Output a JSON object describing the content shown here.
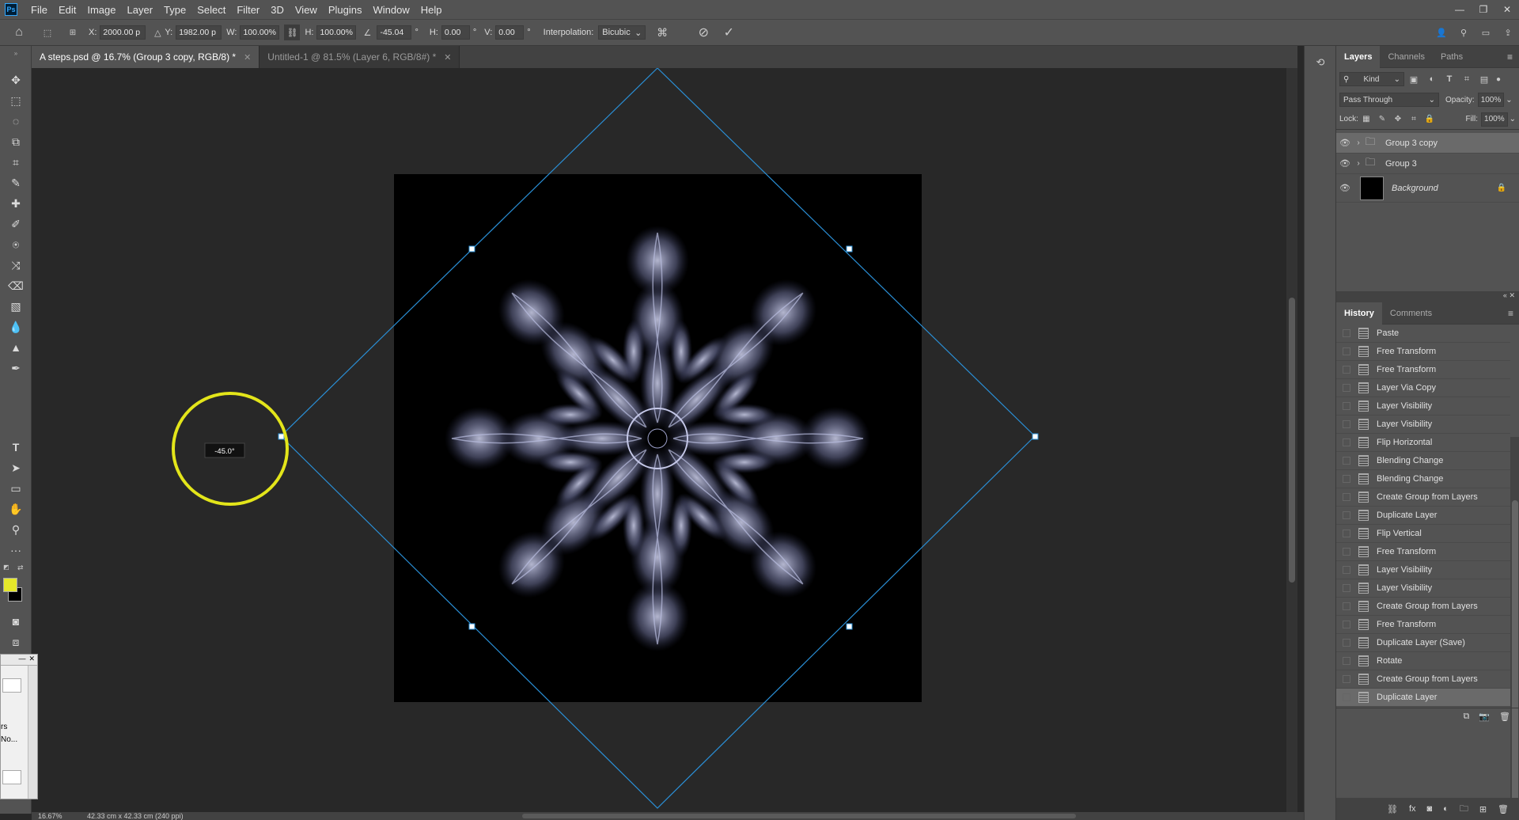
{
  "menu": {
    "logo": "Ps",
    "items": [
      "File",
      "Edit",
      "Image",
      "Layer",
      "Type",
      "Select",
      "Filter",
      "3D",
      "View",
      "Plugins",
      "Window",
      "Help"
    ],
    "window_buttons": [
      "—",
      "❐",
      "✕"
    ]
  },
  "options": {
    "x_label": "X:",
    "x_value": "2000.00 p",
    "y_label": "Y:",
    "y_value": "1982.00 p",
    "w_label": "W:",
    "w_value": "100.00%",
    "h_label": "H:",
    "h_value": "100.00%",
    "angle_value": "-45.04",
    "degree": "°",
    "hskew_label": "H:",
    "hskew_value": "0.00",
    "vskew_label": "V:",
    "vskew_value": "0.00",
    "interp_label": "Interpolation:",
    "interp_value": "Bicubic"
  },
  "tabs": [
    {
      "label": "A steps.psd @ 16.7% (Group 3 copy, RGB/8) *",
      "close": "✕"
    },
    {
      "label": "Untitled-1 @ 81.5% (Layer 6, RGB/8#) *",
      "close": "✕"
    }
  ],
  "canvas": {
    "rotation_readout": "-45.0°",
    "highlight_color": "#e3e51a",
    "bbox_color": "#2a8fd6"
  },
  "foreground_color": "#e5e82a",
  "status": {
    "zoom": "16.67%",
    "doc_size": "42.33 cm x 42.33 cm (240 ppi)"
  },
  "layers_panel": {
    "tabs": [
      "Layers",
      "Channels",
      "Paths"
    ],
    "filter_kind": "Kind",
    "blend_mode": "Pass Through",
    "opacity_label": "Opacity:",
    "opacity_value": "100%",
    "lock_label": "Lock:",
    "fill_label": "Fill:",
    "fill_value": "100%",
    "layers": [
      {
        "name": "Group 3 copy",
        "type": "group",
        "selected": true
      },
      {
        "name": "Group 3",
        "type": "group",
        "selected": false
      },
      {
        "name": "Background",
        "type": "image",
        "selected": false
      }
    ]
  },
  "history_panel": {
    "tabs": [
      "History",
      "Comments"
    ],
    "items": [
      "Paste",
      "Free Transform",
      "Free Transform",
      "Layer Via Copy",
      "Layer Visibility",
      "Layer Visibility",
      "Flip Horizontal",
      "Blending Change",
      "Blending Change",
      "Create Group from Layers",
      "Duplicate Layer",
      "Flip Vertical",
      "Free Transform",
      "Layer Visibility",
      "Layer Visibility",
      "Create Group from Layers",
      "Free Transform",
      "Duplicate Layer (Save)",
      "Rotate",
      "Create Group from Layers",
      "Duplicate Layer"
    ]
  },
  "float_window": {
    "line1": "rs",
    "line2": "No..."
  }
}
